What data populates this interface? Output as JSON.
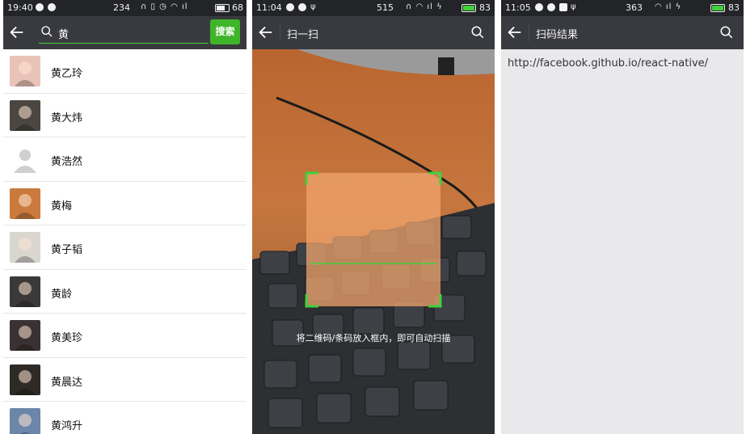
{
  "screens": [
    {
      "status": {
        "time": "19:40",
        "speed": "234",
        "battery": "68"
      },
      "search": {
        "query": "黄",
        "button_label": "搜索"
      },
      "results": [
        {
          "name": "黄乙玲",
          "avatar_color": "#e8c4b8"
        },
        {
          "name": "黄大炜",
          "avatar_color": "#4a4640"
        },
        {
          "name": "黄浩然",
          "avatar_color": "#d8d8d8"
        },
        {
          "name": "黄梅",
          "avatar_color": "#c97a3c"
        },
        {
          "name": "黄子韬",
          "avatar_color": "#d9d6d0"
        },
        {
          "name": "黄龄",
          "avatar_color": "#3b3838"
        },
        {
          "name": "黄美珍",
          "avatar_color": "#3a3232"
        },
        {
          "name": "黄晨达",
          "avatar_color": "#2e2a26"
        },
        {
          "name": "黄鸿升",
          "avatar_color": "#6b86a8"
        }
      ]
    },
    {
      "status": {
        "time": "11:04",
        "speed": "515",
        "battery": "83"
      },
      "title": "扫一扫",
      "hint": "将二维码/条码放入框内，即可自动扫描"
    },
    {
      "status": {
        "time": "11:05",
        "speed": "363",
        "battery": "83"
      },
      "title": "扫码结果",
      "result_text": "http://facebook.github.io/react-native/"
    }
  ],
  "colors": {
    "accent": "#3fd13a",
    "toolbar": "#393a3f",
    "statusbar": "#232427"
  }
}
